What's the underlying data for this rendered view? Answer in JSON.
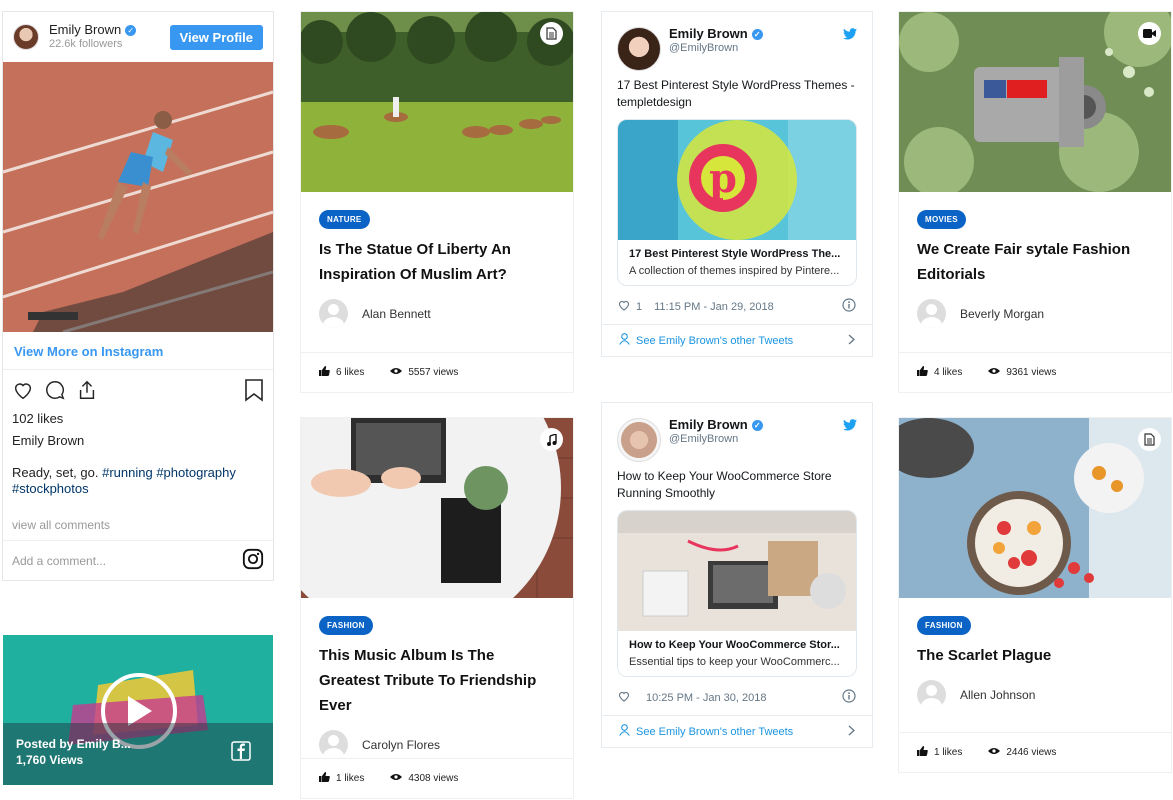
{
  "instagram": {
    "name": "Emily Brown",
    "followers": "22.6k followers",
    "view_profile": "View Profile",
    "view_more": "View More on Instagram",
    "likes": "102 likes",
    "username": "Emily Brown",
    "caption_plain": "Ready, set, go. ",
    "tag1": "#running",
    "tag2": "#photography",
    "tag3": "#stockphotos",
    "view_all": "view all comments",
    "comment_placeholder": "Add a comment..."
  },
  "facebook_video": {
    "posted_by": "Posted by Emily B...",
    "views": "1,760 Views"
  },
  "posts": [
    {
      "badge": "NATURE",
      "title": "Is The Statue Of Liberty An Inspiration Of Muslim Art?",
      "author": "Alan Bennett",
      "likes": "6 likes",
      "views": "5557 views",
      "format_icon": "document-icon"
    },
    {
      "badge": "FASHION",
      "title": "This Music Album Is The Greatest Tribute To Friendship Ever",
      "author": "Carolyn Flores",
      "likes": "1 likes",
      "views": "4308 views",
      "format_icon": "music-icon"
    },
    {
      "badge": "MOVIES",
      "title": "We Create Fair sytale Fashion Editorials",
      "author": "Beverly Morgan",
      "likes": "4 likes",
      "views": "9361 views",
      "format_icon": "video-camera-icon"
    },
    {
      "badge": "FASHION",
      "title": "The Scarlet Plague",
      "author": "Allen Johnson",
      "likes": "1 likes",
      "views": "2446 views",
      "format_icon": "document-icon"
    }
  ],
  "tweets": [
    {
      "name": "Emily Brown",
      "handle": "@EmilyBrown",
      "text": "17 Best Pinterest Style WordPress Themes - templetdesign",
      "link_title": "17 Best Pinterest Style WordPress The...",
      "link_desc": "A collection of themes inspired by Pintere...",
      "likes": "1",
      "time": "11:15 PM - Jan 29, 2018",
      "footer": "See Emily Brown's other Tweets"
    },
    {
      "name": "Emily Brown",
      "handle": "@EmilyBrown",
      "text": "How to Keep Your WooCommerce Store Running Smoothly",
      "link_title": "How to Keep Your WooCommerce Stor...",
      "link_desc": "Essential tips to keep your WooCommerc...",
      "likes": "",
      "time": "10:25 PM - Jan 30, 2018",
      "footer": "See Emily Brown's other Tweets"
    }
  ],
  "colors": {
    "accent": "#0b63c5",
    "instagram_blue": "#3897f0",
    "twitter_blue": "#1da1f2"
  }
}
